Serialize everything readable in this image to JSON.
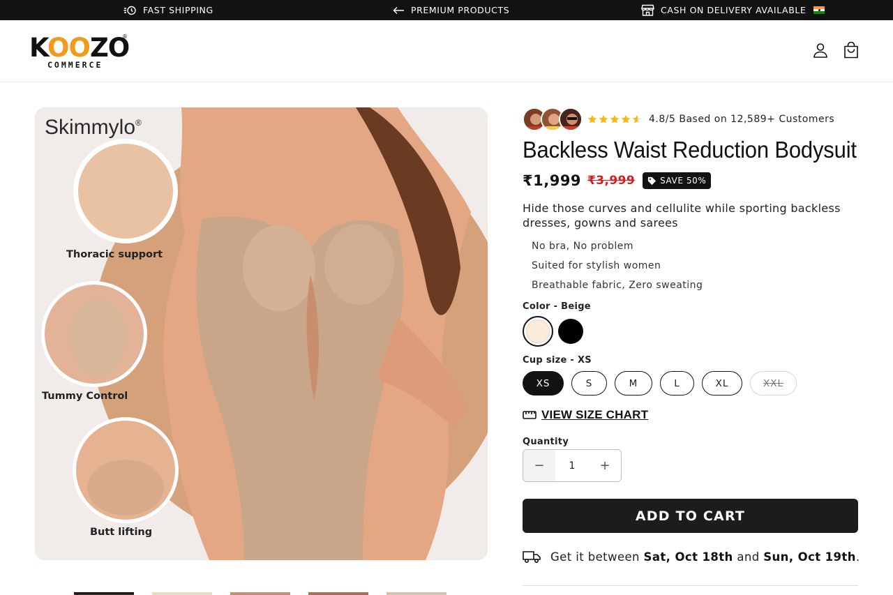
{
  "announcement": {
    "items": [
      {
        "icon": "fast-shipping-icon",
        "label": "FAST SHIPPING"
      },
      {
        "icon": "arrow-left-icon",
        "label": "PREMIUM PRODUCTS"
      },
      {
        "icon": "store-icon",
        "label": "CASH ON DELIVERY AVAILABLE",
        "flag": "india-flag-icon"
      }
    ]
  },
  "header": {
    "logo": {
      "main_prefix": "K",
      "main_oo": "OO",
      "main_suffix": "ZO",
      "sub": "COMMERCE",
      "reg": "®"
    },
    "icons": [
      "account-icon",
      "cart-icon"
    ]
  },
  "gallery": {
    "image_texts": [
      "Skimmylo",
      "Thoracic support",
      "Tummy Control",
      "Butt lifting"
    ],
    "thumbnail_count": 5
  },
  "product": {
    "rating": {
      "stars": 4.8,
      "text": "4.8/5 Based on 12,589+ Customers"
    },
    "title": "Backless Waist Reduction Bodysuit",
    "price": "₹1,999",
    "compare_price": "₹3,999",
    "save_badge": "SAVE 50%",
    "description": "Hide those curves and cellulite while sporting backless dresses, gowns and sarees",
    "bullets": [
      "No bra, No problem",
      "Suited for stylish women",
      "Breathable fabric, Zero sweating"
    ],
    "color": {
      "label": "Color - Beige",
      "options": [
        {
          "name": "Beige",
          "hex": "#fcebd9",
          "selected": true
        },
        {
          "name": "Black",
          "hex": "#000000",
          "selected": false
        }
      ]
    },
    "cup_size": {
      "label": "Cup size - XS",
      "options": [
        {
          "label": "XS",
          "state": "selected"
        },
        {
          "label": "S",
          "state": "available"
        },
        {
          "label": "M",
          "state": "available"
        },
        {
          "label": "L",
          "state": "available"
        },
        {
          "label": "XL",
          "state": "available"
        },
        {
          "label": "XXL",
          "state": "sold-out"
        }
      ]
    },
    "size_chart_label": "VIEW SIZE CHART",
    "quantity": {
      "label": "Quantity",
      "value": "1",
      "minus": "−",
      "plus": "+"
    },
    "add_to_cart_label": "ADD TO CART",
    "delivery": {
      "prefix": "Get it between ",
      "start": "Sat, Oct 18th",
      "middle": " and ",
      "end": "Sun, Oct 19th",
      "suffix": "."
    }
  },
  "colors": {
    "dark": "#121212",
    "accent": "#f19a1e",
    "sale": "#d61c1c",
    "star": "#f5b916"
  }
}
